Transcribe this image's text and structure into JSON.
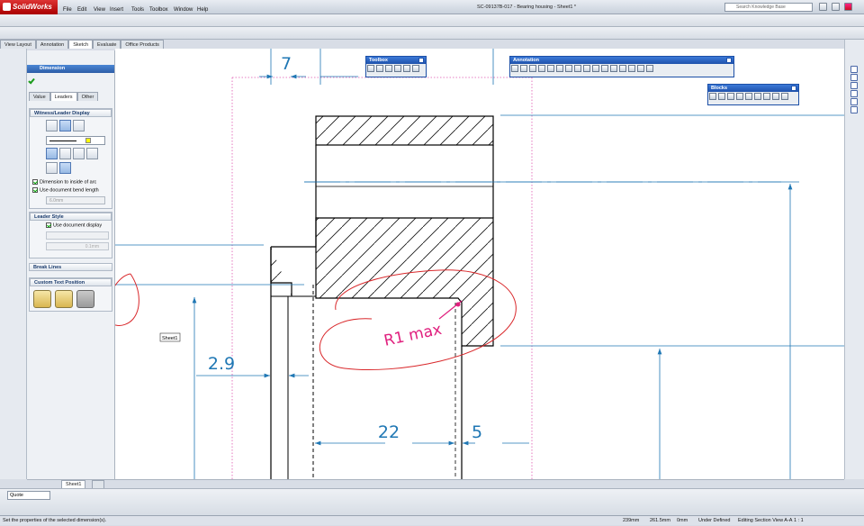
{
  "app": {
    "name": "SolidWorks",
    "document_title": "SC-09137B-017 - Bearing housing - Sheet1 *"
  },
  "menu": [
    "File",
    "Edit",
    "View",
    "Insert",
    "Tools",
    "Toolbox",
    "Window",
    "Help"
  ],
  "search": {
    "placeholder": "Search Knowledge Base"
  },
  "command_tabs": [
    "View Layout",
    "Annotation",
    "Sketch",
    "Evaluate",
    "Office Products"
  ],
  "property_manager": {
    "title": "Dimension",
    "tabs": [
      "Value",
      "Leaders",
      "Other"
    ],
    "witness_section": "Witness/Leader Display",
    "dim_inside_arc": "Dimension to inside of arc",
    "use_doc_bend": "Use document bend length",
    "bend_length": "6.0mm",
    "leader_style": "Leader Style",
    "use_doc_display": "Use document display",
    "leader_thickness": "0.1mm",
    "break_lines": "Break Lines",
    "custom_text_position": "Custom Text Position"
  },
  "toolbars": {
    "toolbox": "Toolbox",
    "annotation": "Annotation",
    "blocks": "Blocks"
  },
  "drawing": {
    "dimensions": [
      "7",
      "2.9",
      "22",
      "5"
    ],
    "note": "R1 max",
    "sheet_tooltip": "Sheet1"
  },
  "sheet_tab": "Sheet1",
  "bottom": {
    "combo_value": "Quote"
  },
  "status": {
    "message": "Set the properties of the selected dimension(s).",
    "x": "239mm",
    "y": "261.5mm",
    "z": "0mm",
    "state": "Under Defined",
    "mode": "Editing Section View A-A",
    "scale": "1 : 1"
  },
  "colors": {
    "dimension": "#1f77b4",
    "markup": "#e0207e",
    "accent": "#2d5ea8"
  }
}
